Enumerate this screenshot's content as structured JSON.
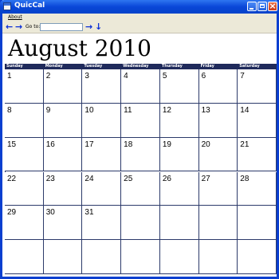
{
  "window": {
    "title": "QuicCal"
  },
  "menu": {
    "items": [
      "About"
    ]
  },
  "toolbar": {
    "goto_label": "Go to:",
    "goto_value": ""
  },
  "calendar": {
    "title": "August 2010",
    "weekdays": [
      "Sunday",
      "Monday",
      "Tuesday",
      "Wednesday",
      "Thursday",
      "Friday",
      "Saturday"
    ],
    "weeks": [
      [
        "1",
        "2",
        "3",
        "4",
        "5",
        "6",
        "7"
      ],
      [
        "8",
        "9",
        "10",
        "11",
        "12",
        "13",
        "14"
      ],
      [
        "15",
        "16",
        "17",
        "18",
        "19",
        "20",
        "21"
      ],
      [
        "22",
        "23",
        "24",
        "25",
        "26",
        "27",
        "28"
      ],
      [
        "29",
        "30",
        "31",
        "",
        "",
        "",
        ""
      ],
      [
        "",
        "",
        "",
        "",
        "",
        "",
        ""
      ]
    ]
  },
  "colors": {
    "titlebar": "#0a46d8",
    "header_band": "#1f2a5b",
    "toolbar_arrow": "#0b2fd6"
  }
}
